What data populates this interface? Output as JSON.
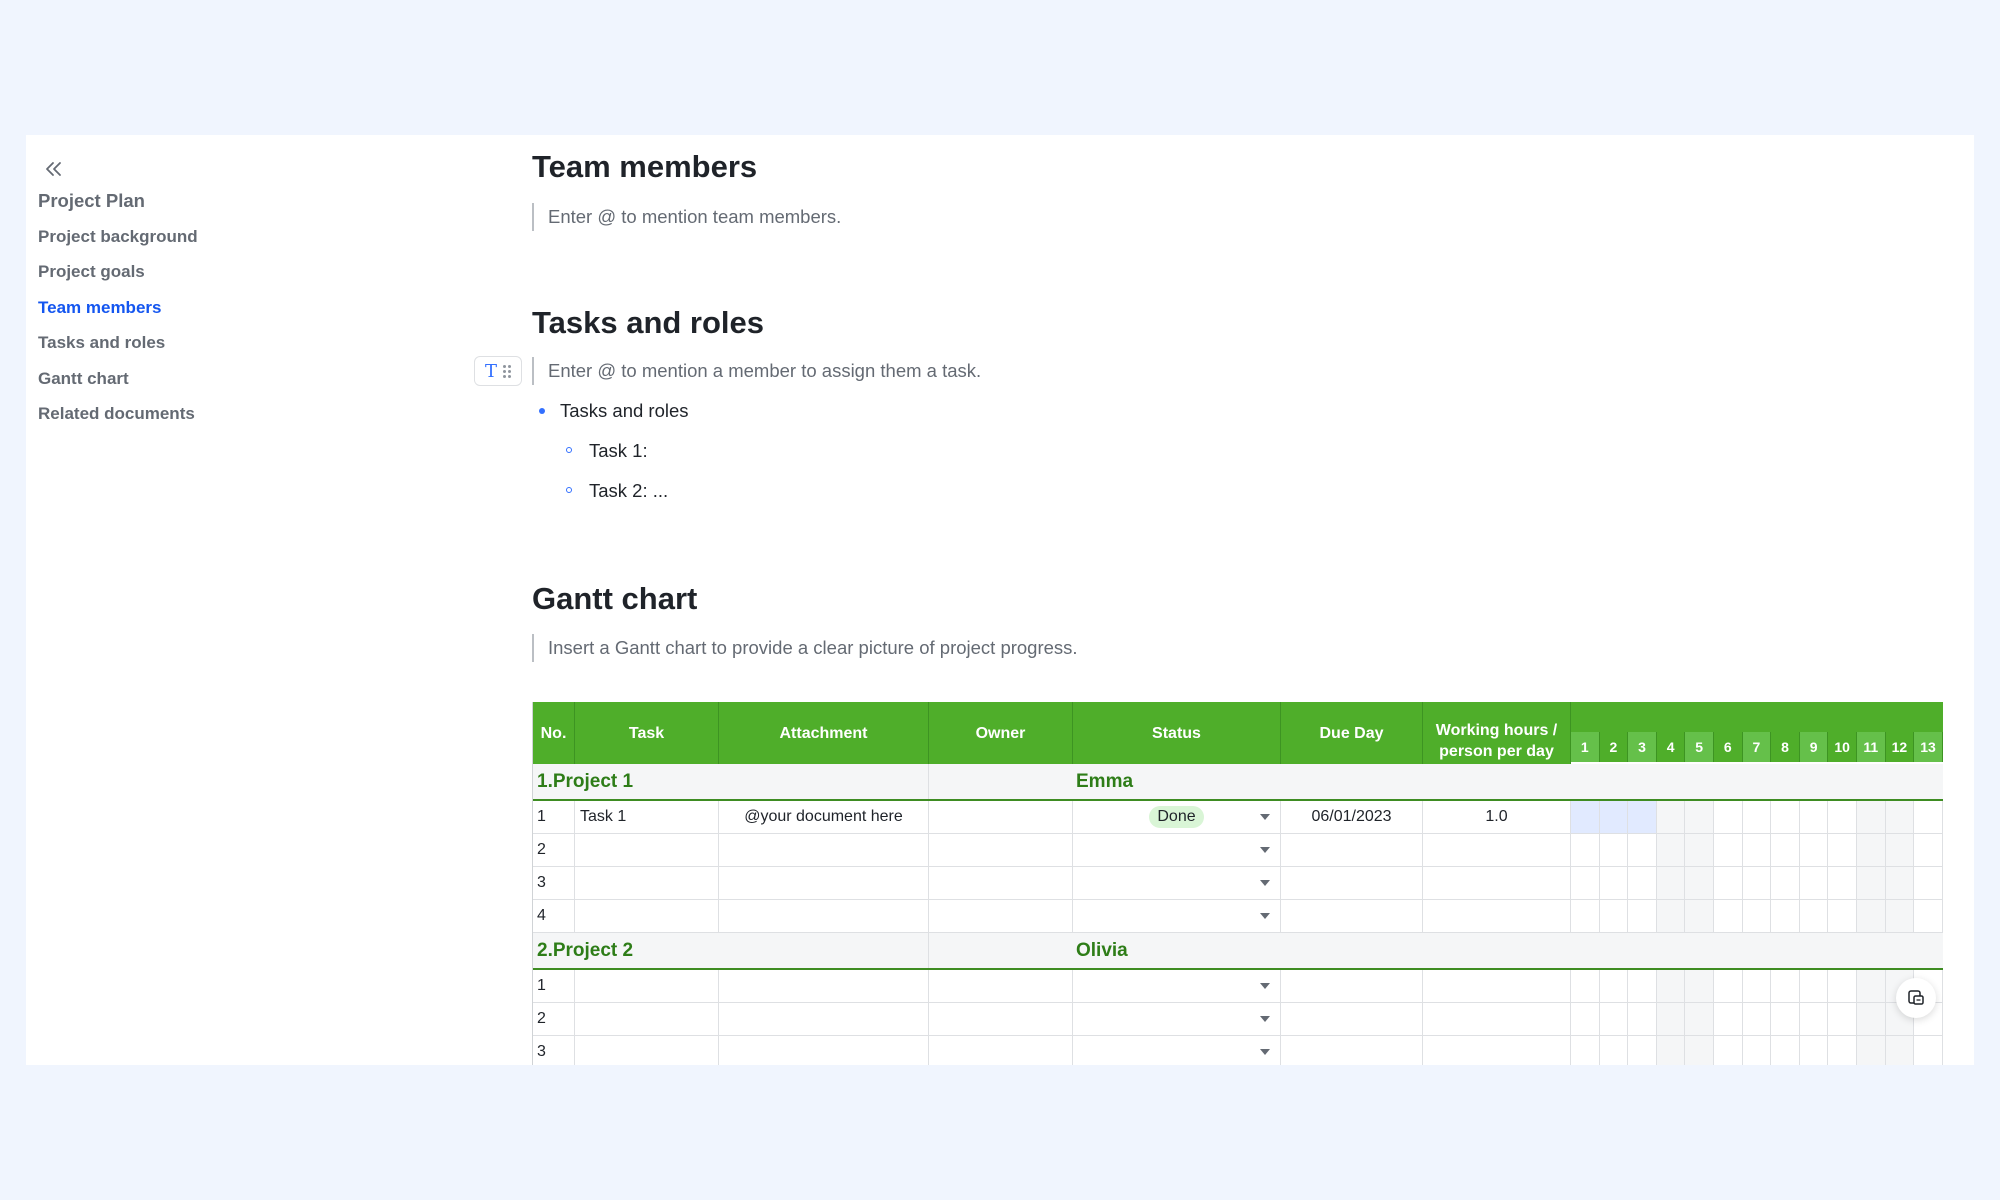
{
  "sidebar": {
    "items": [
      {
        "label": "Project Plan",
        "level": "root"
      },
      {
        "label": "Project background",
        "level": "child"
      },
      {
        "label": "Project goals",
        "level": "child"
      },
      {
        "label": "Team members",
        "level": "child",
        "active": true
      },
      {
        "label": "Tasks and roles",
        "level": "child"
      },
      {
        "label": "Gantt chart",
        "level": "child"
      },
      {
        "label": "Related documents",
        "level": "child"
      }
    ]
  },
  "sections": {
    "team": {
      "title": "Team members",
      "placeholder": "Enter @ to mention team members."
    },
    "tasks": {
      "title": "Tasks and roles",
      "placeholder": "Enter @ to mention a member to assign them a task.",
      "bullet": "Tasks and roles",
      "subs": [
        "Task 1:",
        "Task 2: ..."
      ]
    },
    "gantt": {
      "title": "Gantt chart",
      "placeholder": "Insert a Gantt chart to provide a clear picture of project progress."
    }
  },
  "sheet": {
    "headers": {
      "no": "No.",
      "task": "Task",
      "attachment": "Attachment",
      "owner": "Owner",
      "status": "Status",
      "due": "Due Day",
      "hours": "Working hours / person per day"
    },
    "days": [
      "1",
      "2",
      "3",
      "4",
      "5",
      "6",
      "7",
      "8",
      "9",
      "10",
      "11",
      "12",
      "13"
    ],
    "groups": [
      {
        "name": "1.Project 1",
        "owner": "Emma",
        "rows": [
          {
            "no": "1",
            "task": "Task 1",
            "attachment": "@your document here",
            "status": "Done",
            "due": "06/01/2023",
            "hours": "1.0",
            "bar_days": [
              1,
              2,
              3
            ]
          },
          {
            "no": "2",
            "task": "",
            "attachment": "",
            "status": "",
            "due": "",
            "hours": "",
            "bar_days": []
          },
          {
            "no": "3",
            "task": "",
            "attachment": "",
            "status": "",
            "due": "",
            "hours": "",
            "bar_days": []
          },
          {
            "no": "4",
            "task": "",
            "attachment": "",
            "status": "",
            "due": "",
            "hours": "",
            "bar_days": []
          }
        ]
      },
      {
        "name": "2.Project 2",
        "owner": "Olivia",
        "rows": [
          {
            "no": "1",
            "task": "",
            "attachment": "",
            "status": "",
            "due": "",
            "hours": "",
            "bar_days": []
          },
          {
            "no": "2",
            "task": "",
            "attachment": "",
            "status": "",
            "due": "",
            "hours": "",
            "bar_days": []
          },
          {
            "no": "3",
            "task": "",
            "attachment": "",
            "status": "",
            "due": "",
            "hours": "",
            "bar_days": []
          }
        ]
      }
    ],
    "weekend_days": [
      4,
      5,
      11,
      12
    ]
  },
  "colors": {
    "accent": "#1456f0",
    "header_green": "#4fae2a",
    "group_green": "#2e7d18",
    "pill_green": "#d9f5d6"
  },
  "icons": {
    "collapse": "double-chevron-left-icon",
    "block": "text-block-icon",
    "float": "comment-icon"
  }
}
